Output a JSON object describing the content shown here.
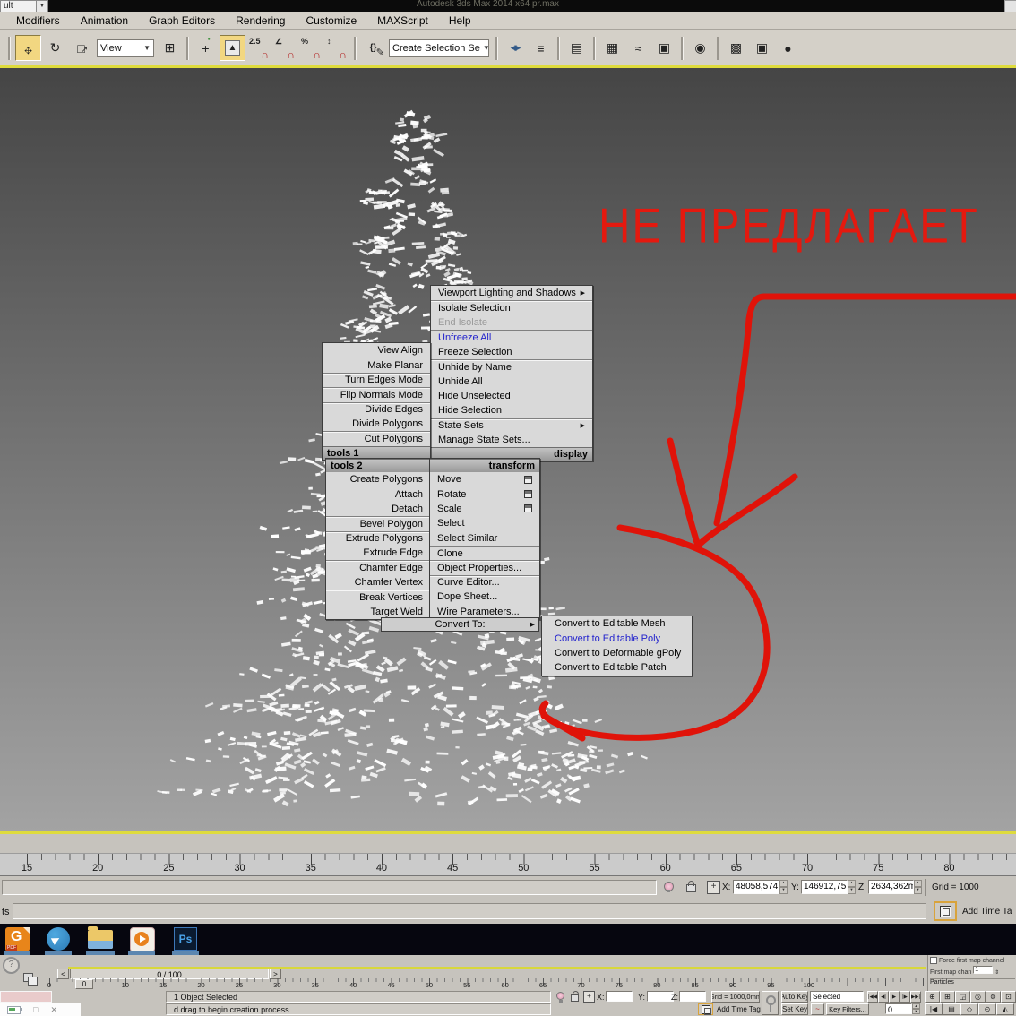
{
  "window": {
    "title": "Autodesk 3ds Max 2014 x64    pr.max",
    "workspace_fragment": "ult"
  },
  "menubar": {
    "items": [
      {
        "label": "Modifiers"
      },
      {
        "label": "Animation"
      },
      {
        "label": "Graph Editors"
      },
      {
        "label": "Rendering"
      },
      {
        "label": "Customize"
      },
      {
        "label": "MAXScript"
      },
      {
        "label": "Help"
      }
    ]
  },
  "toolbar": {
    "view_dropdown": "View",
    "selection_set_field": "Create Selection Se",
    "group1": [
      {
        "name": "separator",
        "cls": "sep"
      },
      {
        "name": "select-and-move-button",
        "g1": "↔",
        "g2": "↕",
        "cls": "active move"
      },
      {
        "name": "select-and-rotate-button",
        "g1": "↻"
      },
      {
        "name": "select-and-scale-button",
        "g1": "□",
        "g2": "↗",
        "cls": "scale"
      }
    ],
    "group2": [
      {
        "name": "use-pivot-center-button",
        "g1": "⊞"
      },
      {
        "name": "separator",
        "cls": "sep"
      },
      {
        "name": "select-and-manipulate-button",
        "g1": "+",
        "g2": "●",
        "cls": "manip"
      },
      {
        "name": "keyboard-override-button",
        "g1": "▲",
        "cls": "active key"
      },
      {
        "name": "snaps-toggle-button",
        "g1": "2.5",
        "g2": "∩",
        "cls": "snap"
      },
      {
        "name": "angle-snap-button",
        "g1": "∠",
        "g2": "∩",
        "cls": "snap"
      },
      {
        "name": "percent-snap-button",
        "g1": "%",
        "g2": "∩",
        "cls": "snap"
      },
      {
        "name": "spinner-snap-button",
        "g1": "↕",
        "g2": "∩",
        "cls": "snap"
      },
      {
        "name": "separator",
        "cls": "sep"
      },
      {
        "name": "named-selection-sets-button",
        "g1": "{}",
        "g2": "✎",
        "cls": "named"
      }
    ],
    "group3": [
      {
        "name": "separator",
        "cls": "sep"
      },
      {
        "name": "mirror-button",
        "g1": "◀▶",
        "cls": "wide"
      },
      {
        "name": "align-button",
        "g1": "≡"
      },
      {
        "name": "separator",
        "cls": "sep"
      },
      {
        "name": "layer-manager-button",
        "g1": "▤"
      },
      {
        "name": "separator",
        "cls": "sep"
      },
      {
        "name": "graph-editors-button",
        "g1": "▦"
      },
      {
        "name": "curve-editor-button",
        "g1": "≈"
      },
      {
        "name": "schematic-view-button",
        "g1": "▣"
      },
      {
        "name": "separator",
        "cls": "sep"
      },
      {
        "name": "material-editor-button",
        "g1": "◉"
      },
      {
        "name": "separator",
        "cls": "sep"
      },
      {
        "name": "render-setup-button",
        "g1": "▩"
      },
      {
        "name": "rendered-frame-button",
        "g1": "▣"
      },
      {
        "name": "render-production-button",
        "g1": "●"
      }
    ]
  },
  "quad": {
    "display": {
      "header": "display",
      "items": [
        {
          "label": "Viewport Lighting and Shadows",
          "arrow": "▶"
        },
        {
          "label": "Isolate Selection",
          "cls": "sep"
        },
        {
          "label": "End Isolate",
          "cls": "disabled"
        },
        {
          "label": "Unfreeze All",
          "cls": "sep link"
        },
        {
          "label": "Freeze Selection"
        },
        {
          "label": "Unhide by Name",
          "cls": "sep"
        },
        {
          "label": "Unhide All"
        },
        {
          "label": "Hide Unselected"
        },
        {
          "label": "Hide Selection"
        },
        {
          "label": "State Sets",
          "cls": "sep",
          "arrow": "▶"
        },
        {
          "label": "Manage State Sets..."
        }
      ]
    },
    "tools1": {
      "header": "tools 1",
      "items": [
        {
          "label": "View Align"
        },
        {
          "label": "Make Planar"
        },
        {
          "label": "Turn Edges Mode",
          "cls": "sep"
        },
        {
          "label": "Flip Normals Mode",
          "cls": "sep"
        },
        {
          "label": "Divide Edges",
          "cls": "sep"
        },
        {
          "label": "Divide Polygons"
        },
        {
          "label": "Cut Polygons",
          "cls": "sep"
        }
      ]
    },
    "tools2": {
      "header": "tools 2",
      "items": [
        {
          "label": "Create Polygons"
        },
        {
          "label": "Attach"
        },
        {
          "label": "Detach"
        },
        {
          "label": "Bevel Polygon",
          "cls": "sep"
        },
        {
          "label": "Extrude Polygons",
          "cls": "sep"
        },
        {
          "label": "Extrude Edge"
        },
        {
          "label": "Chamfer Edge",
          "cls": "sep"
        },
        {
          "label": "Chamfer Vertex"
        },
        {
          "label": "Break Vertices",
          "cls": "sep"
        },
        {
          "label": "Target Weld"
        }
      ]
    },
    "transform": {
      "header": "transform",
      "items": [
        {
          "label": "Move",
          "cls": "hasbox"
        },
        {
          "label": "Rotate",
          "cls": "hasbox"
        },
        {
          "label": "Scale",
          "cls": "hasbox"
        },
        {
          "label": "Select"
        },
        {
          "label": "Select Similar"
        },
        {
          "label": "Clone",
          "cls": "sep"
        },
        {
          "label": "Object Properties...",
          "cls": "sep"
        },
        {
          "label": "Curve Editor...",
          "cls": "sep"
        },
        {
          "label": "Dope Sheet..."
        },
        {
          "label": "Wire Parameters..."
        }
      ]
    },
    "convert_row": {
      "label": "Convert To:",
      "arrow": "▶"
    },
    "submenu": {
      "items": [
        {
          "label": "Convert to Editable Mesh"
        },
        {
          "label": "Convert to Editable Poly",
          "cls": "link"
        },
        {
          "label": "Convert to Deformable gPoly"
        },
        {
          "label": "Convert to Editable Patch"
        }
      ]
    }
  },
  "annotation": {
    "text": "НЕ ПРЕДЛАГАЕТ",
    "color": "#e4190f"
  },
  "rulers": {
    "main": [
      "15",
      "20",
      "25",
      "30",
      "35",
      "40",
      "45",
      "50",
      "55",
      "60",
      "65",
      "70",
      "75",
      "80"
    ],
    "mini": [
      "0",
      "5",
      "10",
      "15",
      "20",
      "25",
      "30",
      "35",
      "40",
      "45",
      "50",
      "55",
      "60",
      "65",
      "70",
      "75",
      "80",
      "85",
      "90",
      "95",
      "100"
    ]
  },
  "status_top": {
    "shapes": "ts",
    "x_label": "X:",
    "x": "48058,574",
    "y_label": "Y:",
    "y": "146912,75",
    "z_label": "Z:",
    "z": "2634,362m",
    "grid": "Grid = 1000",
    "add_time": "Add Time Ta"
  },
  "status_bottom": {
    "time": "0 / 100",
    "thumb": "0",
    "selected": "1 Object Selected",
    "prompt": "d drag to begin creation process",
    "x_label": "X:",
    "y_label": "Y:",
    "z_label": "Z:",
    "grid": "Grid = 1000,0mm",
    "auto_key": "Auto Key",
    "set_key": "Set Key",
    "key_filters": "Key Filters...",
    "selection_filter": "Selected",
    "add_time": "Add Time Tag",
    "frame": "0",
    "transport": [
      {
        "name": "go-to-start-button",
        "g": "|◀◀"
      },
      {
        "name": "previous-frame-button",
        "g": "◀|"
      },
      {
        "name": "play-button",
        "g": "▶"
      },
      {
        "name": "next-frame-button",
        "g": "|▶"
      },
      {
        "name": "go-to-end-button",
        "g": "▶▶|"
      }
    ],
    "nav_tools": [
      {
        "name": "zoom-button",
        "g": "⊕"
      },
      {
        "name": "zoom-extents-button",
        "g": "⊞"
      },
      {
        "name": "zoom-region-button",
        "g": "◲"
      },
      {
        "name": "field-of-view-button",
        "g": "◎"
      },
      {
        "name": "pan-button",
        "g": "⊜"
      },
      {
        "name": "maximize-viewport-button",
        "g": "⊡"
      }
    ],
    "nav_tools2": [
      {
        "name": "previous-key-button",
        "g": "|◀"
      },
      {
        "name": "mini-curve-editor-button",
        "g": "▤"
      },
      {
        "name": "pan-hand-button",
        "g": "◇"
      },
      {
        "name": "orbit-button",
        "g": "⊙"
      },
      {
        "name": "walkthrough-button",
        "g": "◭"
      }
    ]
  },
  "panel": {
    "force_map": "Force first map channel",
    "first_map": "First map chan",
    "first_map_value": "1",
    "particles": "Particles"
  },
  "taskbar": {
    "pdf_letter": "G",
    "pdf_badge": "PDF",
    "ps_label": "Ps"
  }
}
